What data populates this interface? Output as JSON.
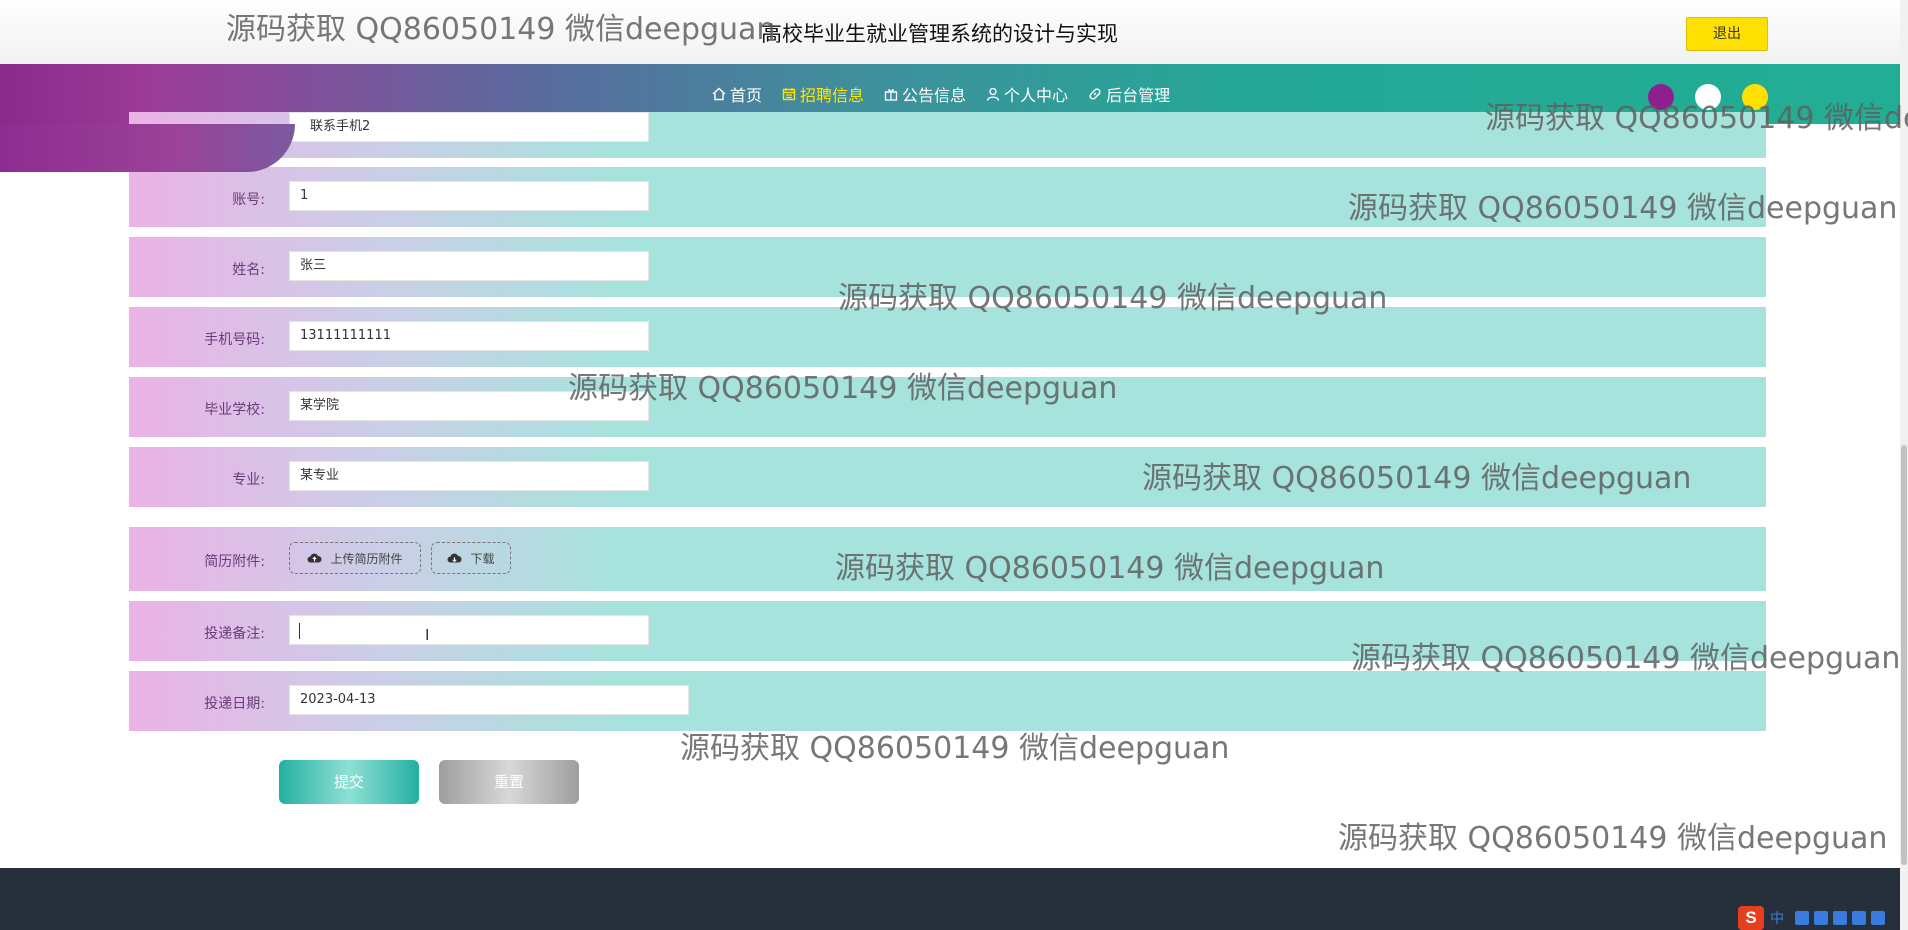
{
  "header": {
    "title": "高校毕业生就业管理系统的设计与实现",
    "logout_label": "退出"
  },
  "nav": {
    "items": [
      {
        "label": "首页",
        "icon": "home-icon",
        "active": false
      },
      {
        "label": "招聘信息",
        "icon": "calendar-icon",
        "active": true
      },
      {
        "label": "公告信息",
        "icon": "gift-icon",
        "active": false
      },
      {
        "label": "个人中心",
        "icon": "user-icon",
        "active": false
      },
      {
        "label": "后台管理",
        "icon": "link-icon",
        "active": false
      }
    ],
    "theme_dots": [
      "#8e1f8f",
      "#ffffff",
      "#ffe000"
    ]
  },
  "form": {
    "partial_field_value": "联系手机2",
    "fields": [
      {
        "label": "账号:",
        "value": "1"
      },
      {
        "label": "姓名:",
        "value": "张三"
      },
      {
        "label": "手机号码:",
        "value": "13111111111"
      },
      {
        "label": "毕业学校:",
        "value": "某学院"
      },
      {
        "label": "专业:",
        "value": "某专业"
      }
    ],
    "resume": {
      "label": "简历附件:",
      "upload_label": "上传简历附件",
      "download_label": "下载"
    },
    "note": {
      "label": "投递备注:",
      "value": ""
    },
    "date": {
      "label": "投递日期:",
      "value": "2023-04-13"
    },
    "submit_label": "提交",
    "reset_label": "重置"
  },
  "ime": {
    "logo": "S",
    "text": "中"
  },
  "watermark": "源码获取 QQ86050149 微信deepguan",
  "colors": {
    "accent_yellow": "#ffe000",
    "row_teal": "#a6e3dc",
    "row_pink": "#ebb3e6",
    "submit": "#22b0a1",
    "footer": "#25303c"
  }
}
